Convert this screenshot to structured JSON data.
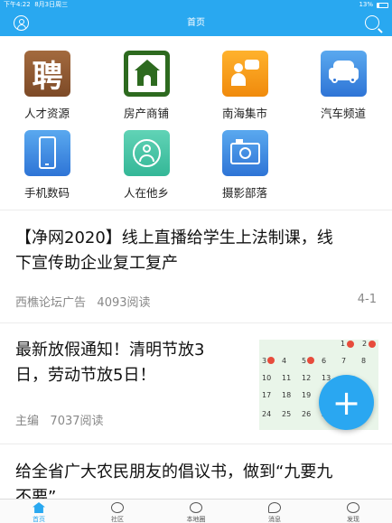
{
  "status_bar": {
    "time": "下午4:22",
    "date": "8月3日周三",
    "battery": "13%"
  },
  "header": {
    "title": "首页",
    "left_icon": "user-icon",
    "right_icon": "search-icon"
  },
  "grid": [
    {
      "label": "人才资源",
      "icon": "recruit-icon",
      "glyph": "聘",
      "color": "#8b5a33"
    },
    {
      "label": "房产商铺",
      "icon": "house-icon",
      "color": "#2d6a1f"
    },
    {
      "label": "南海集市",
      "icon": "market-icon",
      "color": "#f5a01c"
    },
    {
      "label": "汽车频道",
      "icon": "car-icon",
      "color": "#3a84de"
    },
    {
      "label": "手机数码",
      "icon": "phone-icon",
      "color": "#3a84de"
    },
    {
      "label": "人在他乡",
      "icon": "person-icon",
      "color": "#45c3a4"
    },
    {
      "label": "摄影部落",
      "icon": "camera-icon",
      "color": "#3a84de"
    }
  ],
  "news": [
    {
      "title_line1": "【净网2020】线上直播给学生上法制课，线",
      "title_line2": "下宣传助企业复工复产",
      "source": "西樵论坛广告",
      "reads": "4093阅读",
      "date": "4-1"
    },
    {
      "title_line1": "最新放假通知！清明节放3",
      "title_line2": "日，劳动节放5日！",
      "source": "主编",
      "reads": "7037阅读",
      "thumbnail": "calendar-thumbnail"
    },
    {
      "title_line1": "给全省广大农民朋友的倡议书，做到“九要九",
      "title_line2": "不要”"
    }
  ],
  "fab": {
    "label": "+",
    "icon": "plus-icon"
  },
  "tabs": [
    {
      "label": "首页",
      "icon": "home-icon",
      "active": true
    },
    {
      "label": "社区",
      "icon": "community-icon",
      "active": false
    },
    {
      "label": "本地圈",
      "icon": "local-circle-icon",
      "active": false
    },
    {
      "label": "消息",
      "icon": "message-icon",
      "active": false
    },
    {
      "label": "发现",
      "icon": "discover-icon",
      "active": false
    }
  ],
  "colors": {
    "brand": "#29a8f0",
    "text": "#111111",
    "meta": "#888888"
  }
}
